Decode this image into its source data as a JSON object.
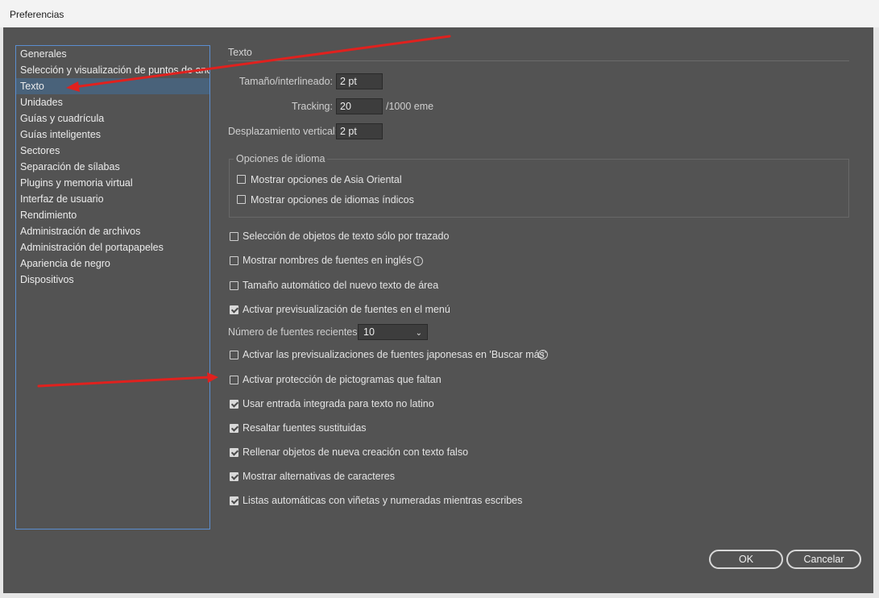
{
  "window": {
    "title": "Preferencias"
  },
  "sidebar": {
    "items": [
      {
        "label": "Generales",
        "active": false
      },
      {
        "label": "Selección y visualización de puntos de ancla",
        "active": false
      },
      {
        "label": "Texto",
        "active": true
      },
      {
        "label": "Unidades",
        "active": false
      },
      {
        "label": "Guías y cuadrícula",
        "active": false
      },
      {
        "label": "Guías inteligentes",
        "active": false
      },
      {
        "label": "Sectores",
        "active": false
      },
      {
        "label": "Separación de sílabas",
        "active": false
      },
      {
        "label": "Plugins y memoria virtual",
        "active": false
      },
      {
        "label": "Interfaz de usuario",
        "active": false
      },
      {
        "label": "Rendimiento",
        "active": false
      },
      {
        "label": "Administración de archivos",
        "active": false
      },
      {
        "label": "Administración del portapapeles",
        "active": false
      },
      {
        "label": "Apariencia de negro",
        "active": false
      },
      {
        "label": "Dispositivos",
        "active": false
      }
    ]
  },
  "main": {
    "section_title": "Texto",
    "size_leading": {
      "label": "Tamaño/interlineado:",
      "value": "2 pt"
    },
    "tracking": {
      "label": "Tracking:",
      "value": "20",
      "unit": "/1000 eme"
    },
    "baseline_shift": {
      "label": "Desplazamiento vertical:",
      "value": "2 pt"
    },
    "language_options": {
      "title": "Opciones de idioma",
      "east_asian": {
        "label": "Mostrar opciones de Asia Oriental",
        "checked": false
      },
      "indic": {
        "label": "Mostrar opciones de idiomas índicos",
        "checked": false
      }
    },
    "opt_select_by_path": {
      "label": "Selección de objetos de texto sólo por trazado",
      "checked": false
    },
    "opt_font_names_english": {
      "label": "Mostrar nombres de fuentes en inglés",
      "checked": false
    },
    "opt_auto_size": {
      "label": "Tamaño automático del nuevo texto de área",
      "checked": false
    },
    "opt_font_preview": {
      "label": "Activar previsualización de fuentes en el menú",
      "checked": true
    },
    "recent_fonts": {
      "label": "Número de fuentes recientes:",
      "value": "10"
    },
    "opt_japanese_preview": {
      "label": "Activar las previsualizaciones de fuentes japonesas en 'Buscar más'",
      "checked": false
    },
    "opt_missing_glyph": {
      "label": "Activar protección de pictogramas que faltan",
      "checked": false
    },
    "opt_inline_input": {
      "label": "Usar entrada integrada para texto no latino",
      "checked": true
    },
    "opt_highlight_substituted": {
      "label": "Resaltar fuentes sustituidas",
      "checked": true
    },
    "opt_fill_placeholder": {
      "label": "Rellenar objetos de nueva creación con texto falso",
      "checked": true
    },
    "opt_show_alternates": {
      "label": "Mostrar alternativas de caracteres",
      "checked": true
    },
    "opt_auto_lists": {
      "label": "Listas automáticas con viñetas y numeradas mientras escribes",
      "checked": true
    }
  },
  "buttons": {
    "ok": "OK",
    "cancel": "Cancelar"
  },
  "annotations": {
    "arrow_color": "#e0211e"
  },
  "colors": {
    "dialog_bg": "#535353",
    "selection": "#49627a",
    "sidebar_border": "#5b8ed0"
  }
}
